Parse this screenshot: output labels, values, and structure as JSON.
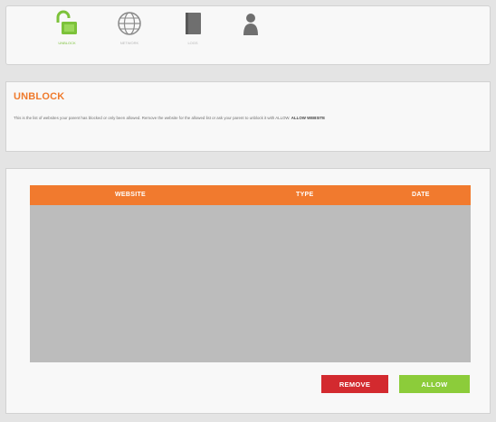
{
  "toolbar": {
    "items": [
      {
        "id": "unblock",
        "label": "UNBLOCK",
        "icon": "unlock-icon",
        "active": true
      },
      {
        "id": "network",
        "label": "NETWORK",
        "icon": "globe-icon",
        "active": false
      },
      {
        "id": "logs",
        "label": "LOGS",
        "icon": "document-icon",
        "active": false
      },
      {
        "id": "account",
        "label": "",
        "icon": "user-icon",
        "active": false
      }
    ]
  },
  "unblock": {
    "title": "UNBLOCK",
    "description": "This is the list of websites your parent has blocked or only been allowed. Remove the website for the allowed list or ask your parent to unblock it with ALLOW.",
    "description_bold": "ALLOW WEBSITE"
  },
  "table": {
    "columns": [
      "WEBSITE",
      "TYPE",
      "DATE"
    ],
    "rows": []
  },
  "buttons": {
    "remove": "REMOVE",
    "allow": "ALLOW"
  },
  "colors": {
    "accent": "#f17a2e",
    "active": "#7cc23a",
    "danger": "#d32a2f",
    "success": "#8ccc3a"
  }
}
